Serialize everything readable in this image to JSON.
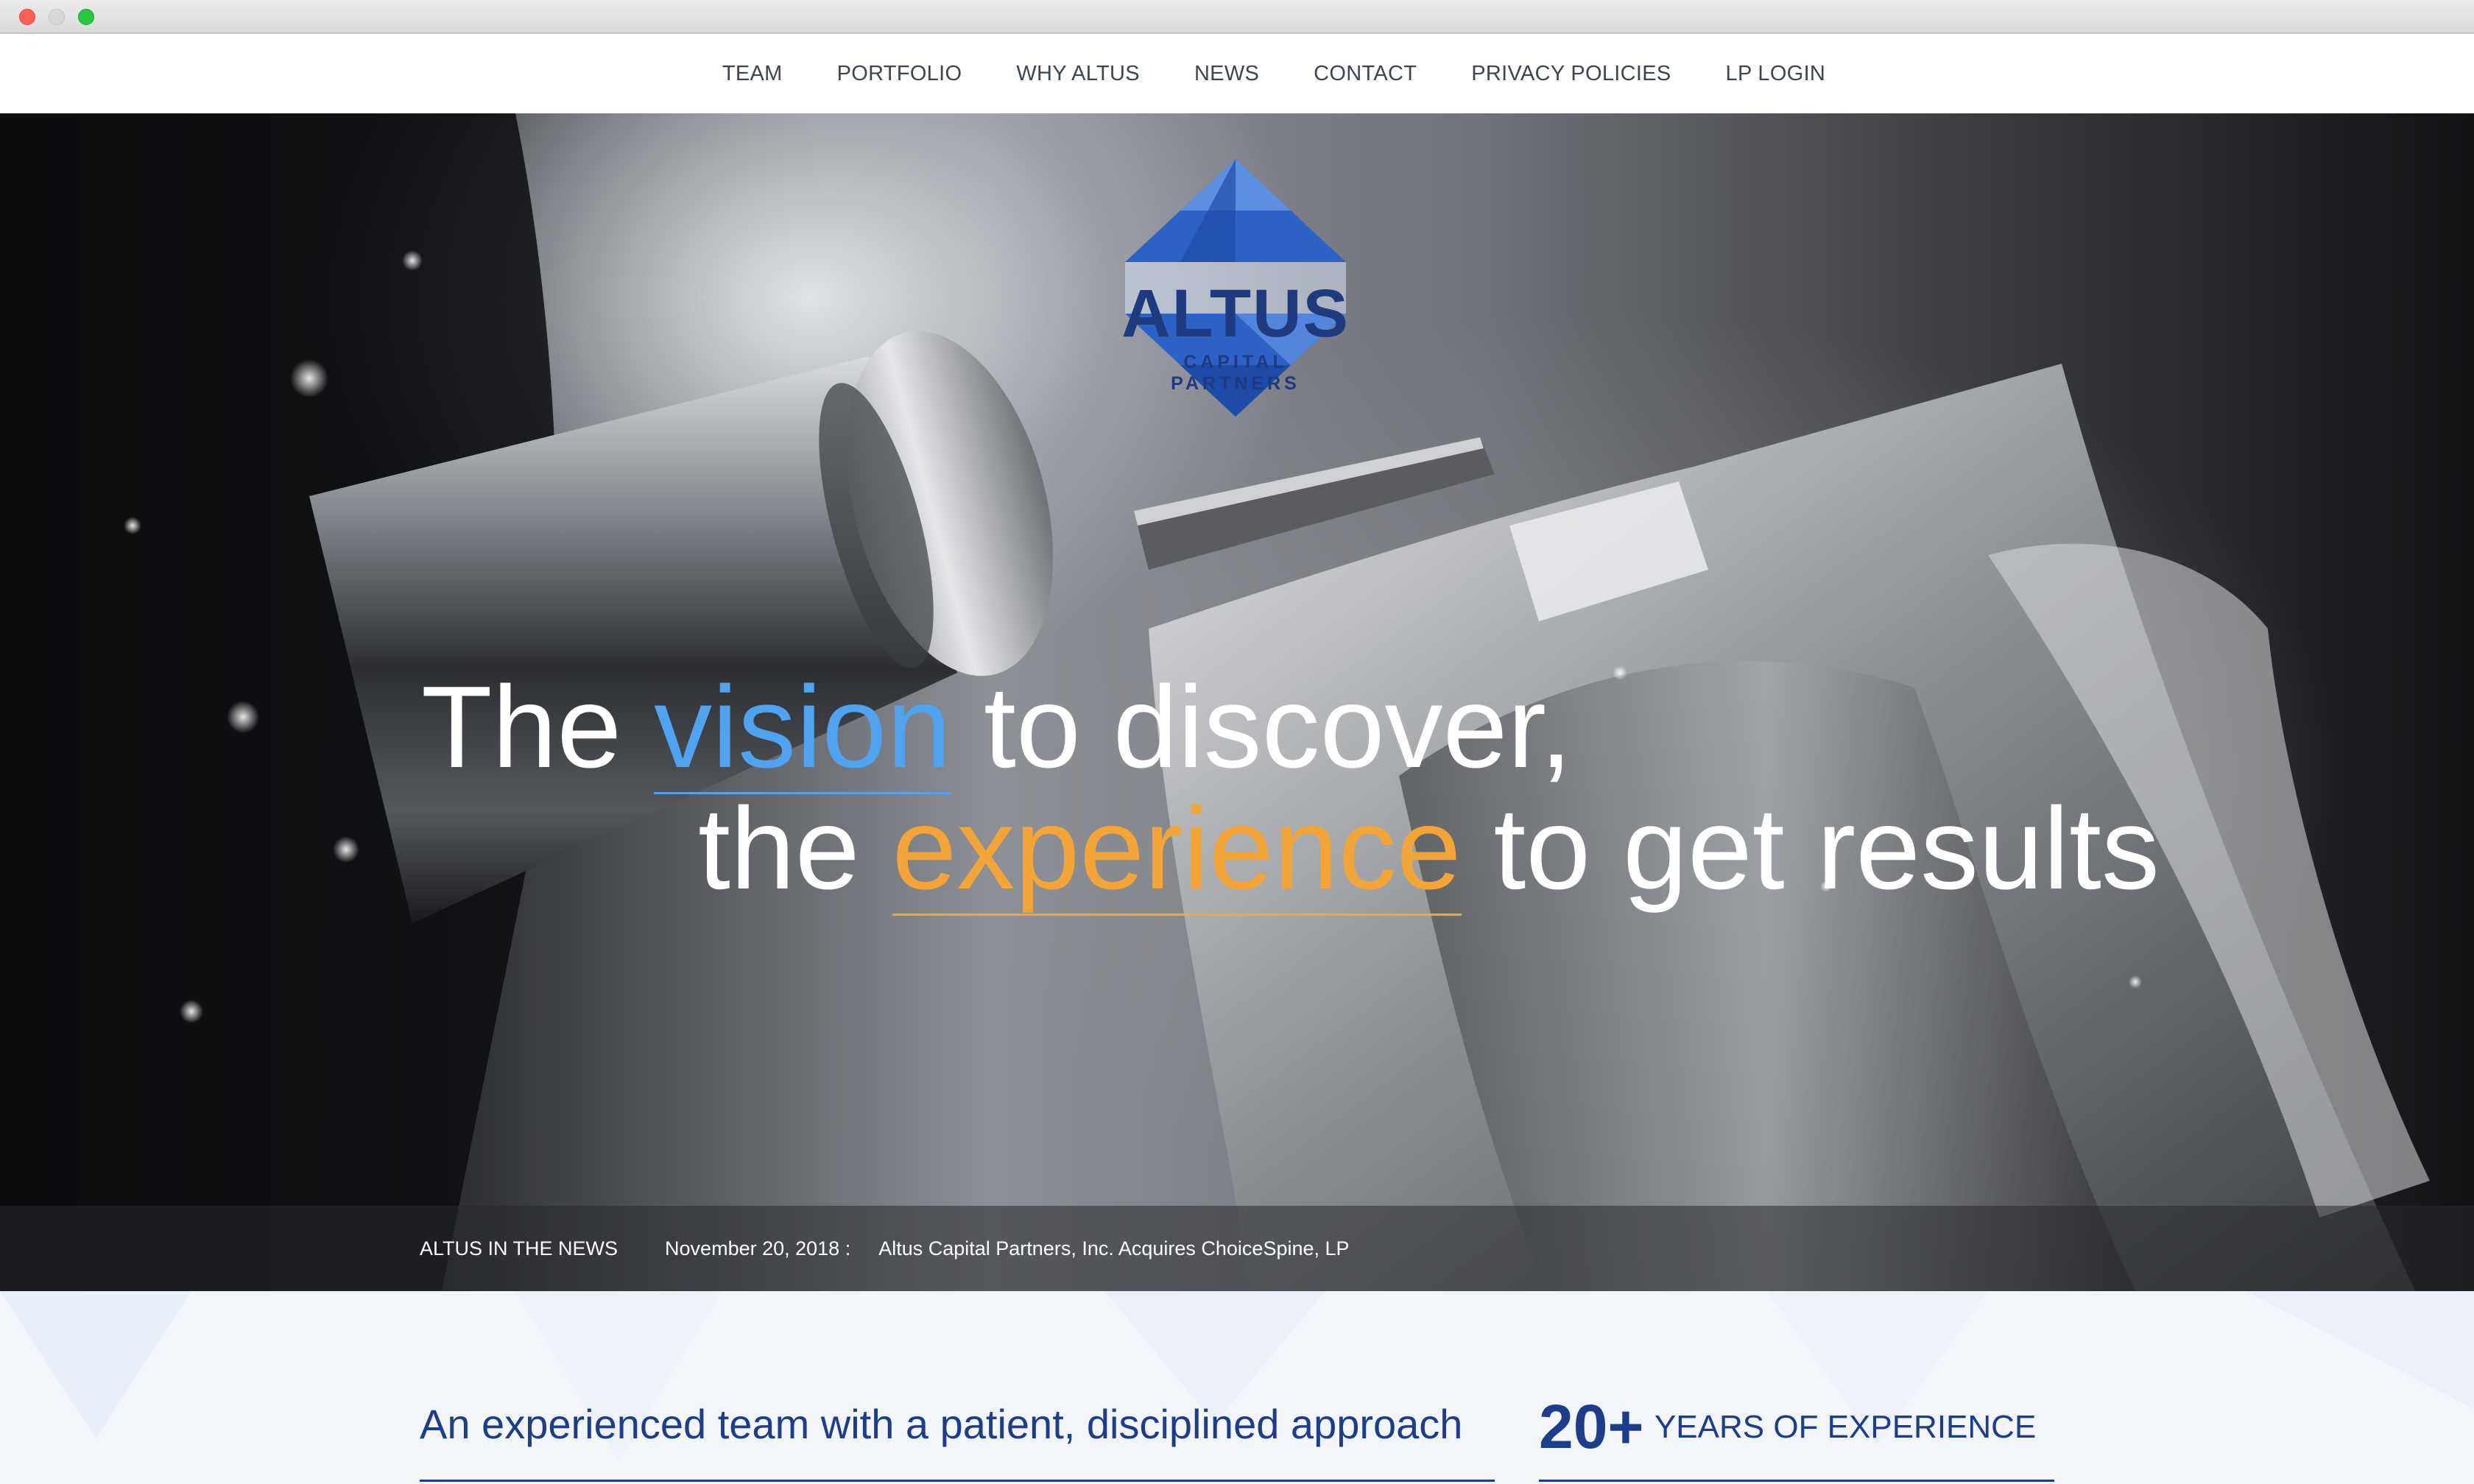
{
  "window": {
    "controls": [
      "close",
      "minimize",
      "zoom"
    ]
  },
  "nav": {
    "items": [
      {
        "label": "TEAM"
      },
      {
        "label": "PORTFOLIO"
      },
      {
        "label": "WHY ALTUS"
      },
      {
        "label": "NEWS"
      },
      {
        "label": "CONTACT"
      },
      {
        "label": "PRIVACY POLICIES"
      },
      {
        "label": "LP LOGIN"
      }
    ]
  },
  "logo": {
    "name": "ALTUS",
    "subtitle": "CAPITAL PARTNERS",
    "mark": "®"
  },
  "hero": {
    "line1_pre": "The ",
    "line1_highlight": "vision",
    "line1_post": " to discover,",
    "line2_pre": "the ",
    "line2_highlight": "experience",
    "line2_post": " to get results"
  },
  "news": {
    "label": "ALTUS IN THE NEWS",
    "date": "November 20, 2018 :",
    "headline": "Altus Capital Partners, Inc. Acquires ChoiceSpine, LP"
  },
  "intro": {
    "heading": "An experienced team with a patient, disciplined approach",
    "years_number": "20+",
    "years_label": "YEARS OF EXPERIENCE"
  },
  "colors": {
    "brand_navy": "#1f3a7e",
    "brand_blue": "#4fa3f0",
    "accent_orange": "#f3a637",
    "text_dark": "#3e4552"
  }
}
